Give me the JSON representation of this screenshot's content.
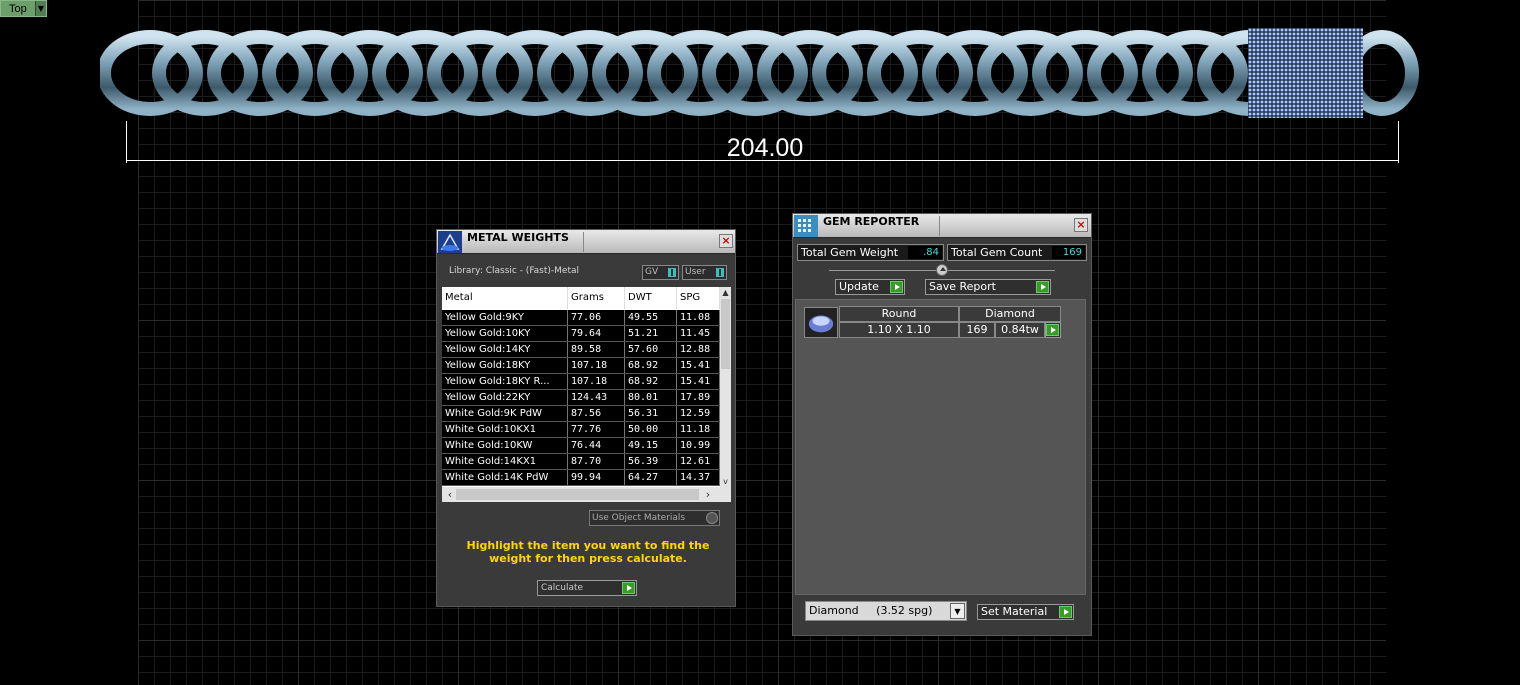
{
  "viewport": {
    "view_name": "Top",
    "dimension": "204.00"
  },
  "metal_weights": {
    "title": "METAL WEIGHTS",
    "library": "Library: Classic - (Fast)-Metal",
    "toggle_gv": "GV",
    "toggle_user": "User",
    "columns": [
      "Metal",
      "Grams",
      "DWT",
      "SPG"
    ],
    "rows": [
      [
        "Yellow Gold:9KY",
        "77.06",
        "49.55",
        "11.08"
      ],
      [
        "Yellow Gold:10KY",
        "79.64",
        "51.21",
        "11.45"
      ],
      [
        "Yellow Gold:14KY",
        "89.58",
        "57.60",
        "12.88"
      ],
      [
        "Yellow Gold:18KY",
        "107.18",
        "68.92",
        "15.41"
      ],
      [
        "Yellow Gold:18KY R...",
        "107.18",
        "68.92",
        "15.41"
      ],
      [
        "Yellow Gold:22KY",
        "124.43",
        "80.01",
        "17.89"
      ],
      [
        "White Gold:9K PdW",
        "87.56",
        "56.31",
        "12.59"
      ],
      [
        "White Gold:10KX1",
        "77.76",
        "50.00",
        "11.18"
      ],
      [
        "White Gold:10KW",
        "76.44",
        "49.15",
        "10.99"
      ],
      [
        "White Gold:14KX1",
        "87.70",
        "56.39",
        "12.61"
      ],
      [
        "White Gold:14K PdW",
        "99.94",
        "64.27",
        "14.37"
      ]
    ],
    "use_object_materials": "Use Object Materials",
    "hint": "Highlight the item you want to find the weight for then press calculate.",
    "calculate": "Calculate"
  },
  "gem_reporter": {
    "title": "GEM REPORTER",
    "total_weight_label": "Total Gem Weight",
    "total_weight_value": ".84",
    "total_count_label": "Total Gem Count",
    "total_count_value": "169",
    "update": "Update",
    "save_report": "Save Report",
    "gem": {
      "shape": "Round",
      "material": "Diamond",
      "size": "1.10 X 1.10",
      "count": "169",
      "weight": "0.84tw"
    },
    "material_select": "Diamond     (3.52 spg)",
    "set_material": "Set Material"
  },
  "colors": {
    "hint_text": "#ffd700",
    "go_button": "#3a9a2a",
    "value_text": "#44dddd"
  }
}
